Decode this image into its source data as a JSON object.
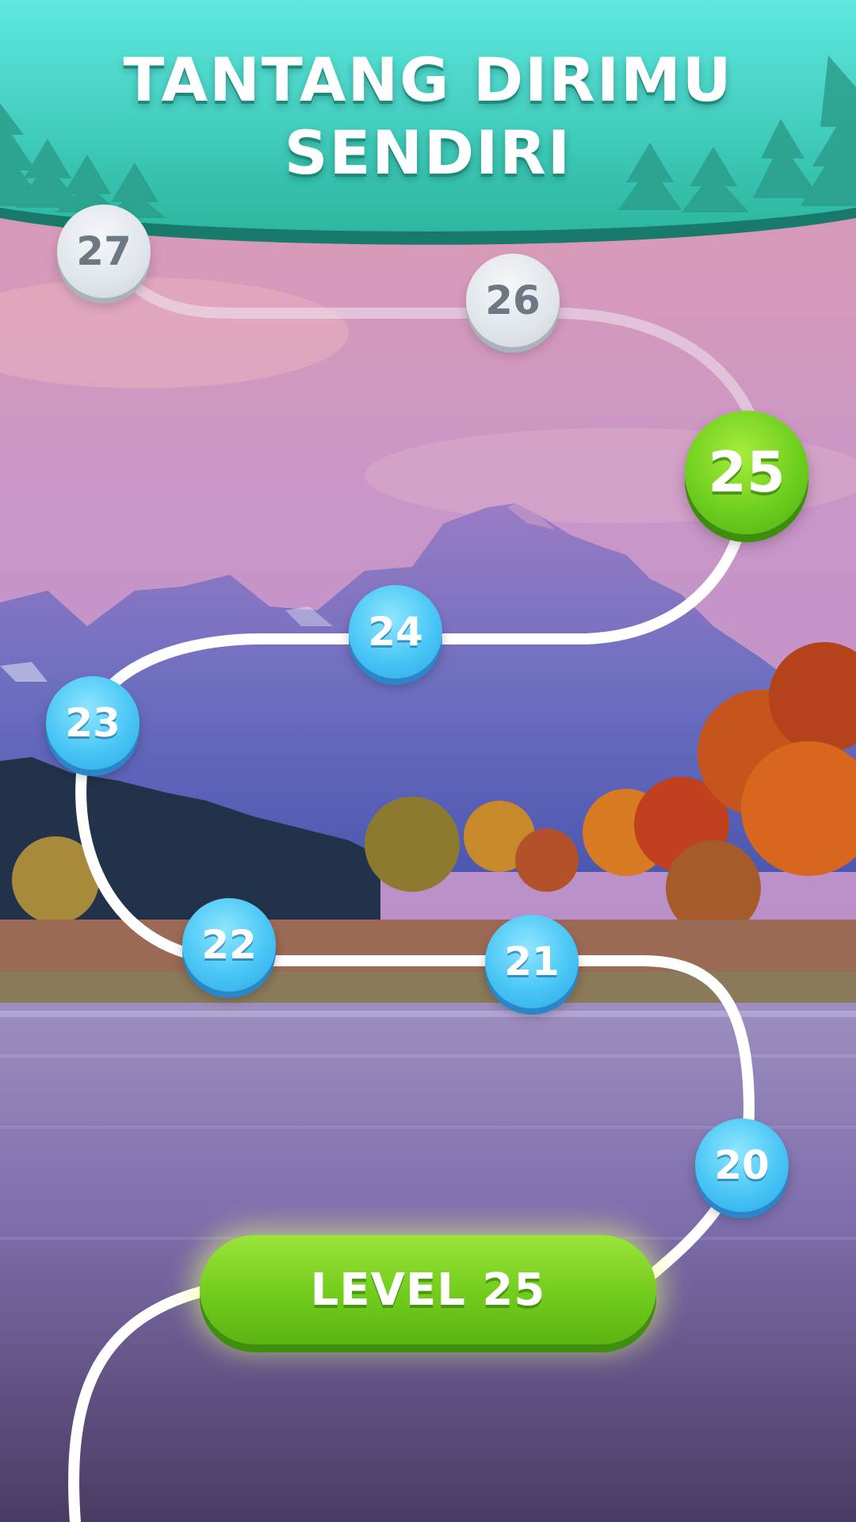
{
  "header": {
    "title_line1": "TANTANG DIRIMU",
    "title_line2": "SENDIRI"
  },
  "level_map": {
    "current_level": "25",
    "levels": [
      {
        "label": "27",
        "state": "locked"
      },
      {
        "label": "26",
        "state": "locked"
      },
      {
        "label": "25",
        "state": "current"
      },
      {
        "label": "24",
        "state": "completed"
      },
      {
        "label": "23",
        "state": "completed"
      },
      {
        "label": "22",
        "state": "completed"
      },
      {
        "label": "21",
        "state": "completed"
      },
      {
        "label": "20",
        "state": "completed"
      }
    ]
  },
  "play_button": {
    "label": "LEVEL 25"
  },
  "colors": {
    "header": "#3fd3c3",
    "completed_node": "#49c6f5",
    "current_node": "#6fcf1e",
    "locked_node": "#e0e5ea",
    "play_button": "#72cc1c"
  }
}
